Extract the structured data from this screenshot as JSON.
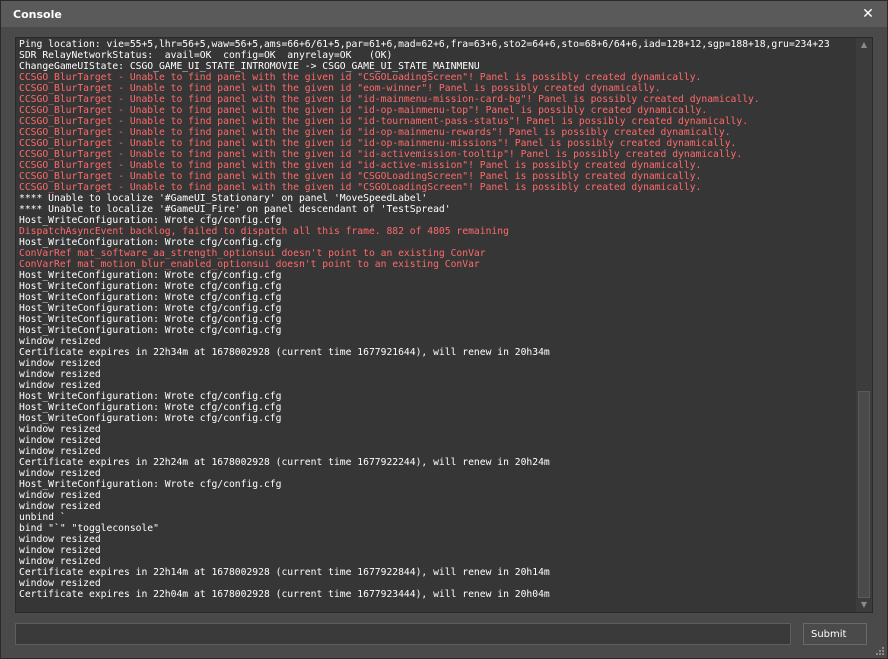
{
  "window": {
    "title": "Console",
    "close_glyph": "✕"
  },
  "console": {
    "lines": [
      {
        "text": "Ping location: vie=55+5,lhr=56+5,waw=56+5,ams=66+6/61+5,par=61+6,mad=62+6,fra=63+6,sto2=64+6,sto=68+6/64+6,iad=128+12,sgp=188+18,gru=234+23",
        "type": "normal"
      },
      {
        "text": "SDR RelayNetworkStatus:  avail=OK  config=OK  anyrelay=OK   (OK)",
        "type": "normal"
      },
      {
        "text": "ChangeGameUIState: CSGO_GAME_UI_STATE_INTROMOVIE -> CSGO_GAME_UI_STATE_MAINMENU",
        "type": "normal"
      },
      {
        "text": "CCSGO_BlurTarget - Unable to find panel with the given id \"CSGOLoadingScreen\"! Panel is possibly created dynamically.",
        "type": "error"
      },
      {
        "text": "CCSGO_BlurTarget - Unable to find panel with the given id \"eom-winner\"! Panel is possibly created dynamically.",
        "type": "error"
      },
      {
        "text": "CCSGO_BlurTarget - Unable to find panel with the given id \"id-mainmenu-mission-card-bg\"! Panel is possibly created dynamically.",
        "type": "error"
      },
      {
        "text": "CCSGO_BlurTarget - Unable to find panel with the given id \"id-op-mainmenu-top\"! Panel is possibly created dynamically.",
        "type": "error"
      },
      {
        "text": "CCSGO_BlurTarget - Unable to find panel with the given id \"id-tournament-pass-status\"! Panel is possibly created dynamically.",
        "type": "error"
      },
      {
        "text": "CCSGO_BlurTarget - Unable to find panel with the given id \"id-op-mainmenu-rewards\"! Panel is possibly created dynamically.",
        "type": "error"
      },
      {
        "text": "CCSGO_BlurTarget - Unable to find panel with the given id \"id-op-mainmenu-missions\"! Panel is possibly created dynamically.",
        "type": "error"
      },
      {
        "text": "CCSGO_BlurTarget - Unable to find panel with the given id \"id-activemission-tooltip\"! Panel is possibly created dynamically.",
        "type": "error"
      },
      {
        "text": "CCSGO_BlurTarget - Unable to find panel with the given id \"id-active-mission\"! Panel is possibly created dynamically.",
        "type": "error"
      },
      {
        "text": "CCSGO_BlurTarget - Unable to find panel with the given id \"CSGOLoadingScreen\"! Panel is possibly created dynamically.",
        "type": "error"
      },
      {
        "text": "CCSGO_BlurTarget - Unable to find panel with the given id \"CSGOLoadingScreen\"! Panel is possibly created dynamically.",
        "type": "error"
      },
      {
        "text": "**** Unable to localize '#GameUI_Stationary' on panel 'MoveSpeedLabel'",
        "type": "normal"
      },
      {
        "text": "**** Unable to localize '#GameUI_Fire' on panel descendant of 'TestSpread'",
        "type": "normal"
      },
      {
        "text": "Host_WriteConfiguration: Wrote cfg/config.cfg",
        "type": "normal"
      },
      {
        "text": "DispatchAsyncEvent backlog, failed to dispatch all this frame. 882 of 4805 remaining",
        "type": "error"
      },
      {
        "text": "Host_WriteConfiguration: Wrote cfg/config.cfg",
        "type": "normal"
      },
      {
        "text": "ConVarRef mat_software_aa_strength_optionsui doesn't point to an existing ConVar",
        "type": "error"
      },
      {
        "text": "ConVarRef mat_motion_blur_enabled_optionsui doesn't point to an existing ConVar",
        "type": "error"
      },
      {
        "text": "Host_WriteConfiguration: Wrote cfg/config.cfg",
        "type": "normal"
      },
      {
        "text": "Host_WriteConfiguration: Wrote cfg/config.cfg",
        "type": "normal"
      },
      {
        "text": "Host_WriteConfiguration: Wrote cfg/config.cfg",
        "type": "normal"
      },
      {
        "text": "Host_WriteConfiguration: Wrote cfg/config.cfg",
        "type": "normal"
      },
      {
        "text": "Host_WriteConfiguration: Wrote cfg/config.cfg",
        "type": "normal"
      },
      {
        "text": "Host_WriteConfiguration: Wrote cfg/config.cfg",
        "type": "normal"
      },
      {
        "text": "window resized",
        "type": "normal"
      },
      {
        "text": "Certificate expires in 22h34m at 1678002928 (current time 1677921644), will renew in 20h34m",
        "type": "normal"
      },
      {
        "text": "window resized",
        "type": "normal"
      },
      {
        "text": "window resized",
        "type": "normal"
      },
      {
        "text": "window resized",
        "type": "normal"
      },
      {
        "text": "Host_WriteConfiguration: Wrote cfg/config.cfg",
        "type": "normal"
      },
      {
        "text": "Host_WriteConfiguration: Wrote cfg/config.cfg",
        "type": "normal"
      },
      {
        "text": "Host_WriteConfiguration: Wrote cfg/config.cfg",
        "type": "normal"
      },
      {
        "text": "window resized",
        "type": "normal"
      },
      {
        "text": "window resized",
        "type": "normal"
      },
      {
        "text": "window resized",
        "type": "normal"
      },
      {
        "text": "Certificate expires in 22h24m at 1678002928 (current time 1677922244), will renew in 20h24m",
        "type": "normal"
      },
      {
        "text": "window resized",
        "type": "normal"
      },
      {
        "text": "Host_WriteConfiguration: Wrote cfg/config.cfg",
        "type": "normal"
      },
      {
        "text": "window resized",
        "type": "normal"
      },
      {
        "text": "window resized",
        "type": "normal"
      },
      {
        "text": "unbind `",
        "type": "normal"
      },
      {
        "text": "bind \"`\" \"toggleconsole\"",
        "type": "normal"
      },
      {
        "text": "window resized",
        "type": "normal"
      },
      {
        "text": "window resized",
        "type": "normal"
      },
      {
        "text": "window resized",
        "type": "normal"
      },
      {
        "text": "Certificate expires in 22h14m at 1678002928 (current time 1677922844), will renew in 20h14m",
        "type": "normal"
      },
      {
        "text": "window resized",
        "type": "normal"
      },
      {
        "text": "Certificate expires in 22h04m at 1678002928 (current time 1677923444), will renew in 20h04m",
        "type": "normal"
      }
    ]
  },
  "scrollbar": {
    "up_glyph": "▲",
    "down_glyph": "▼",
    "thumb_start": 0.62,
    "thumb_size": 0.38
  },
  "input": {
    "value": "",
    "placeholder": ""
  },
  "submit": {
    "label": "Submit"
  },
  "colors": {
    "normal_text": "#ffffff",
    "error_text": "#ff6a6a",
    "background": "#4a4a4a",
    "console_bg": "#363636"
  }
}
